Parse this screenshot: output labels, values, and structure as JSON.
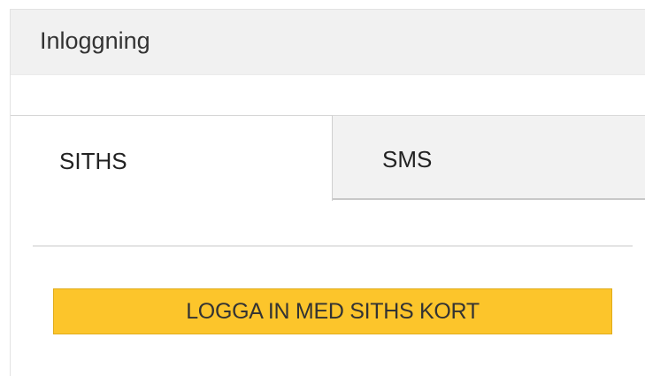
{
  "panel": {
    "title": "Inloggning"
  },
  "tabs": [
    {
      "label": "SITHS",
      "active": true
    },
    {
      "label": "SMS",
      "active": false
    }
  ],
  "actions": {
    "login_button_label": "LOGGA IN MED SITHS KORT"
  },
  "colors": {
    "header_background": "#f1f1f1",
    "button_background": "#fcc52b",
    "inactive_tab_background": "#f2f2f2"
  }
}
